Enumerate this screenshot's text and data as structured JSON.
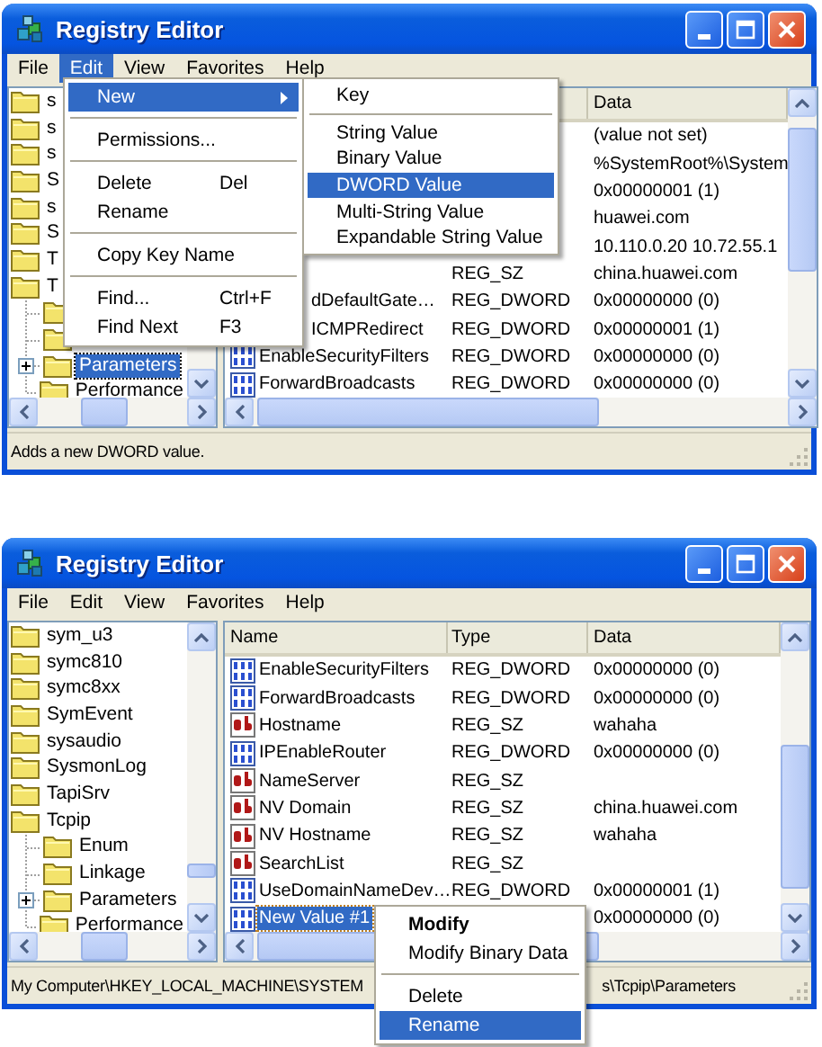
{
  "windows": [
    {
      "title": "Registry Editor",
      "menu": [
        {
          "label": "File",
          "selected": false
        },
        {
          "label": "Edit",
          "selected": true
        },
        {
          "label": "View",
          "selected": false
        },
        {
          "label": "Favorites",
          "selected": false
        },
        {
          "label": "Help",
          "selected": false
        }
      ],
      "tree": [
        {
          "label": "s",
          "selected": false
        },
        {
          "label": "s",
          "selected": false
        },
        {
          "label": "s",
          "selected": false
        },
        {
          "label": "S",
          "selected": false
        },
        {
          "label": "s",
          "selected": false
        },
        {
          "label": "S",
          "selected": false
        },
        {
          "label": "T",
          "selected": false
        },
        {
          "label": "T",
          "selected": false,
          "children": [
            {
              "expandable": false
            },
            {
              "expandable": false
            },
            {
              "label": "Parameters",
              "expandable": true,
              "selected": true
            },
            {
              "label": "Performance",
              "expandable": false,
              "selected": false
            }
          ]
        }
      ],
      "header": {
        "data": "Data"
      },
      "rows": [
        {
          "kind": "covered",
          "data": "(value not set)"
        },
        {
          "kind": "covered",
          "data": "%SystemRoot%\\System"
        },
        {
          "kind": "covered",
          "data": "0x00000001 (1)"
        },
        {
          "kind": "covered",
          "data": "huawei.com"
        },
        {
          "kind": "covered",
          "data": "10.110.0.20 10.72.55.1"
        },
        {
          "kind": "covered",
          "type": "REG_SZ",
          "data": "china.huawei.com"
        },
        {
          "kind": "covered",
          "name": "dDefaultGate…",
          "type": "REG_DWORD",
          "data": "0x00000000 (0)",
          "selected": false
        },
        {
          "kind": "covered",
          "name": "ICMPRedirect",
          "type": "REG_DWORD",
          "data": "0x00000001 (1)",
          "selected": false
        },
        {
          "kind": "dword",
          "name": "EnableSecurityFilters",
          "type": "REG_DWORD",
          "data": "0x00000000 (0)",
          "selected": false
        },
        {
          "kind": "dword",
          "name": "ForwardBroadcasts",
          "type": "REG_DWORD",
          "data": "0x00000000 (0)",
          "selected": false
        }
      ],
      "status": [
        "Adds a new DWORD value."
      ],
      "edit_menu": [
        {
          "kind": "item",
          "label": "New",
          "has_submenu": true,
          "selected": true
        },
        {
          "kind": "separator"
        },
        {
          "kind": "item",
          "label": "Permissions...",
          "has_submenu": false,
          "selected": false
        },
        {
          "kind": "separator"
        },
        {
          "kind": "item",
          "label": "Delete",
          "shortcut": "Del",
          "has_submenu": false,
          "selected": false
        },
        {
          "kind": "item",
          "label": "Rename",
          "has_submenu": false,
          "selected": false
        },
        {
          "kind": "separator"
        },
        {
          "kind": "item",
          "label": "Copy Key Name",
          "has_submenu": false,
          "selected": false
        },
        {
          "kind": "separator"
        },
        {
          "kind": "item",
          "label": "Find...",
          "shortcut": "Ctrl+F",
          "has_submenu": false,
          "selected": false
        },
        {
          "kind": "item",
          "label": "Find Next",
          "shortcut": "F3",
          "has_submenu": false,
          "selected": false
        }
      ],
      "submenu": [
        {
          "kind": "item",
          "label": "Key",
          "selected": false
        },
        {
          "kind": "separator"
        },
        {
          "kind": "item",
          "label": "String Value",
          "selected": false
        },
        {
          "kind": "item",
          "label": "Binary Value",
          "selected": false
        },
        {
          "kind": "item",
          "label": "DWORD Value",
          "selected": true
        },
        {
          "kind": "item",
          "label": "Multi-String Value",
          "selected": false
        },
        {
          "kind": "item",
          "label": "Expandable String Value",
          "selected": false
        }
      ]
    },
    {
      "title": "Registry Editor",
      "menu": [
        {
          "label": "File",
          "selected": false
        },
        {
          "label": "Edit",
          "selected": false
        },
        {
          "label": "View",
          "selected": false
        },
        {
          "label": "Favorites",
          "selected": false
        },
        {
          "label": "Help",
          "selected": false
        }
      ],
      "tree": [
        {
          "label": "sym_u3",
          "selected": false
        },
        {
          "label": "symc810",
          "selected": false
        },
        {
          "label": "symc8xx",
          "selected": false
        },
        {
          "label": "SymEvent",
          "selected": false
        },
        {
          "label": "sysaudio",
          "selected": false
        },
        {
          "label": "SysmonLog",
          "selected": false
        },
        {
          "label": "TapiSrv",
          "selected": false
        },
        {
          "label": "Tcpip",
          "selected": false,
          "children": [
            {
              "label": "Enum",
              "expandable": false,
              "selected": false
            },
            {
              "label": "Linkage",
              "expandable": false,
              "selected": false
            },
            {
              "label": "Parameters",
              "expandable": true,
              "selected": false
            },
            {
              "label": "Performance",
              "expandable": false,
              "selected": false
            }
          ]
        }
      ],
      "header": {
        "name": "Name",
        "type": "Type",
        "data": "Data"
      },
      "rows": [
        {
          "kind": "dword",
          "name": "EnableSecurityFilters",
          "type": "REG_DWORD",
          "data": "0x00000000 (0)",
          "selected": false
        },
        {
          "kind": "dword",
          "name": "ForwardBroadcasts",
          "type": "REG_DWORD",
          "data": "0x00000000 (0)",
          "selected": false
        },
        {
          "kind": "sz",
          "name": "Hostname",
          "type": "REG_SZ",
          "data": "wahaha",
          "selected": false
        },
        {
          "kind": "dword",
          "name": "IPEnableRouter",
          "type": "REG_DWORD",
          "data": "0x00000000 (0)",
          "selected": false
        },
        {
          "kind": "sz",
          "name": "NameServer",
          "type": "REG_SZ",
          "selected": false
        },
        {
          "kind": "sz",
          "name": "NV Domain",
          "type": "REG_SZ",
          "data": "china.huawei.com",
          "selected": false
        },
        {
          "kind": "sz",
          "name": "NV Hostname",
          "type": "REG_SZ",
          "data": "wahaha",
          "selected": false
        },
        {
          "kind": "sz",
          "name": "SearchList",
          "type": "REG_SZ",
          "selected": false
        },
        {
          "kind": "dword",
          "name": "UseDomainNameDev…",
          "type": "REG_DWORD",
          "data": "0x00000001 (1)",
          "selected": false
        },
        {
          "kind": "dword",
          "name": "New Value #1",
          "data": "0x00000000 (0)",
          "selected": true
        }
      ],
      "status": [
        "My Computer\\HKEY_LOCAL_MACHINE\\SYSTEM",
        "s\\Tcpip\\Parameters"
      ],
      "context_menu": [
        {
          "kind": "item",
          "label": "Modify",
          "default": true,
          "selected": false
        },
        {
          "kind": "item",
          "label": "Modify Binary Data",
          "default": false,
          "selected": false
        },
        {
          "kind": "separator"
        },
        {
          "kind": "item",
          "label": "Delete",
          "default": false,
          "selected": false
        },
        {
          "kind": "item",
          "label": "Rename",
          "default": false,
          "selected": true
        }
      ]
    }
  ]
}
